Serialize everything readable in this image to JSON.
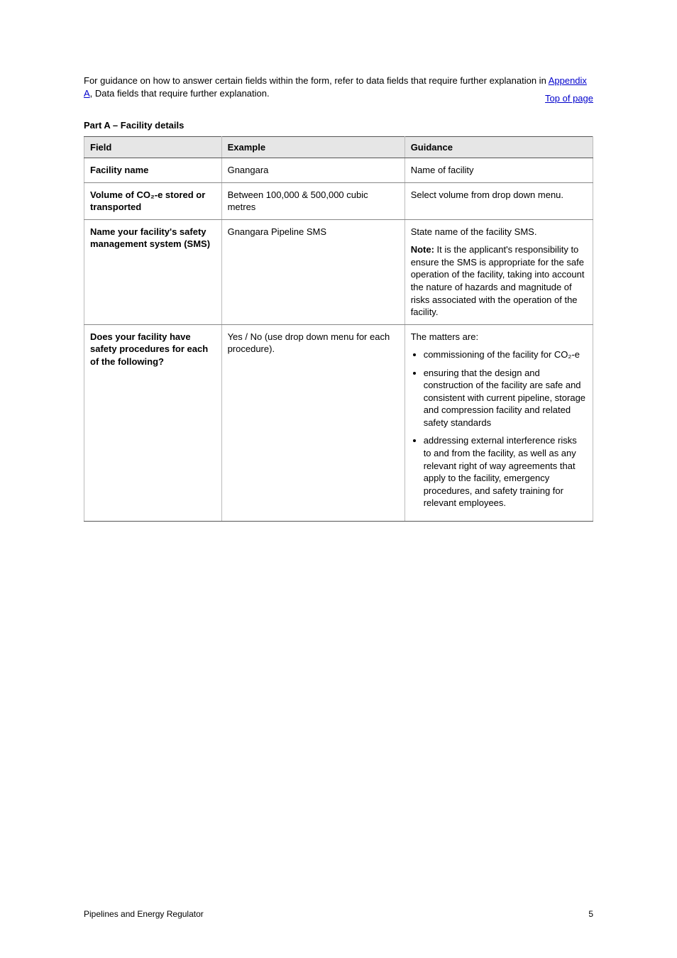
{
  "header": {
    "top_link": "Top of page"
  },
  "intro": {
    "text_before_link": "For guidance on how to answer certain fields within the form, refer to data fields that require further explanation in ",
    "link_text": "Appendix A",
    "text_after_link": ", Data fields that require further explanation."
  },
  "table": {
    "title": "Part A – Facility details",
    "columns": [
      "Field",
      "Example",
      "Guidance"
    ],
    "rows": [
      {
        "field": "Facility name",
        "example": "Gnangara",
        "guidance": "Name of facility"
      },
      {
        "field": "Volume of CO₂-e stored or transported",
        "example": "Between 100,000 & 500,000 cubic metres",
        "guidance": "Select volume from drop down menu."
      },
      {
        "field": "Name your facility's safety management system (SMS)",
        "example": "Gnangara Pipeline SMS",
        "guidance": "State name of the facility SMS.",
        "note_label": "Note:",
        "note_text": "It is the applicant's responsibility to ensure the SMS is appropriate for the safe operation of the facility, taking into account the nature of hazards and magnitude of risks associated with the operation of the facility."
      },
      {
        "field": "Does your facility have safety procedures for each of the following?",
        "example": "Yes / No (use drop down menu for each procedure).",
        "guidance_intro": "The matters are:",
        "guidance_list": [
          "commissioning of the facility for CO₂-e",
          "ensuring that the design and construction of the facility are safe and consistent with current pipeline, storage and compression facility and related safety standards",
          "addressing external interference risks to and from the facility, as well as any relevant right of way agreements that apply to the facility, emergency procedures, and safety training for relevant employees."
        ]
      }
    ]
  },
  "footer": {
    "left": "Pipelines and Energy Regulator",
    "right": "5"
  }
}
